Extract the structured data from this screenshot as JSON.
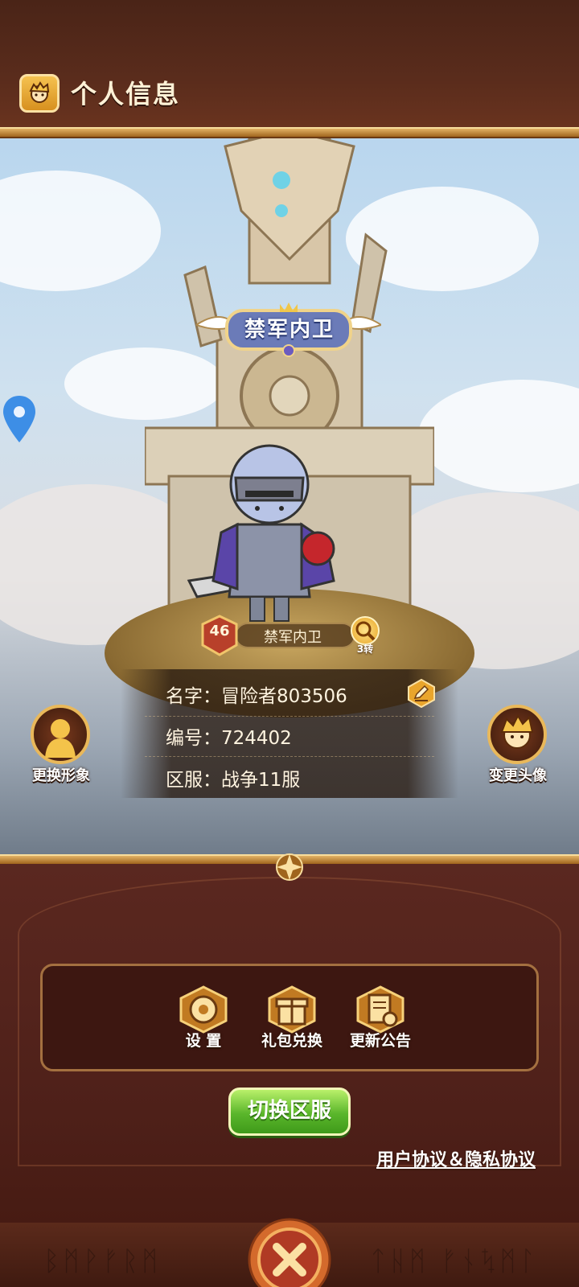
{
  "header": {
    "title": "个人信息",
    "avatar_icon": "hero-avatar-icon"
  },
  "scene": {
    "title_badge": "禁军内卫",
    "level": "46",
    "rank_name": "禁军内卫",
    "rebirth": "3转"
  },
  "profile": {
    "name_label": "名字：冒险者803506",
    "id_label": "编号：724402",
    "server_label": "区服：战争11服"
  },
  "side_buttons": {
    "change_appearance": "更换形象",
    "change_avatar": "变更头像"
  },
  "menu": {
    "items": [
      {
        "label": "设 置",
        "icon": "gear-icon"
      },
      {
        "label": "礼包兑换",
        "icon": "gift-icon"
      },
      {
        "label": "更新公告",
        "icon": "notice-icon"
      }
    ]
  },
  "actions": {
    "switch_server": "切换区服",
    "agreement": "用户协议＆隐私协议"
  },
  "footer": {
    "runes_left": "ᛒᛗᚹᚠᚱᛗ",
    "runes_right": "ᛏᚺᛗ ᚠᚾᛪᛗᛚ"
  },
  "colors": {
    "gold": "#e9b85a",
    "brown": "#4e2019",
    "green": "#5ab62b"
  }
}
